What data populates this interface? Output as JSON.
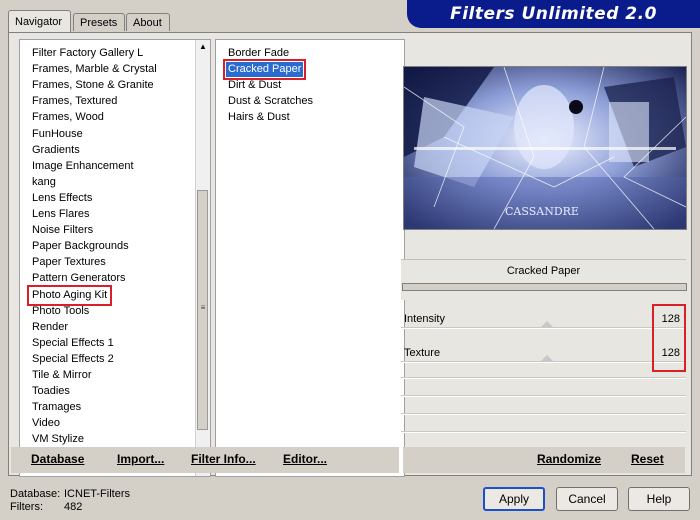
{
  "title": "Filters Unlimited 2.0",
  "tabs": [
    {
      "label": "Navigator",
      "active": true
    },
    {
      "label": "Presets",
      "active": false
    },
    {
      "label": "About",
      "active": false
    }
  ],
  "categories": {
    "items": [
      "Filter Factory Gallery L",
      "Frames, Marble & Crystal",
      "Frames, Stone & Granite",
      "Frames, Textured",
      "Frames, Wood",
      "FunHouse",
      "Gradients",
      "Image Enhancement",
      "kang",
      "Lens Effects",
      "Lens Flares",
      "Noise Filters",
      "Paper Backgrounds",
      "Paper Textures",
      "Pattern Generators",
      "Photo Aging Kit",
      "Photo Tools",
      "Render",
      "Special Effects 1",
      "Special Effects 2",
      "Tile & Mirror",
      "Toadies",
      "Tramages",
      "Video",
      "VM Stylize"
    ],
    "highlighted": "Photo Aging Kit"
  },
  "filters": {
    "items": [
      "Border Fade",
      "Cracked Paper",
      "Dirt & Dust",
      "Dust & Scratches",
      "Hairs & Dust"
    ],
    "selected": "Cracked Paper"
  },
  "preview": {
    "caption": "CASSANDRE"
  },
  "current_filter": "Cracked Paper",
  "params": [
    {
      "label": "Intensity",
      "value": "128"
    },
    {
      "label": "Texture",
      "value": "128"
    }
  ],
  "left_buttons": {
    "database": "Database",
    "import": "Import...",
    "filter_info": "Filter Info...",
    "editor": "Editor..."
  },
  "right_buttons": {
    "randomize": "Randomize",
    "reset": "Reset"
  },
  "status": {
    "database_label": "Database:",
    "database_value": "ICNET-Filters",
    "filters_label": "Filters:",
    "filters_value": "482"
  },
  "dialog_buttons": {
    "apply": "Apply",
    "cancel": "Cancel",
    "help": "Help"
  },
  "colors": {
    "title_bg": "#0a1c8c",
    "highlight_red": "#d8202a",
    "selection_blue": "#2a6bd0"
  }
}
